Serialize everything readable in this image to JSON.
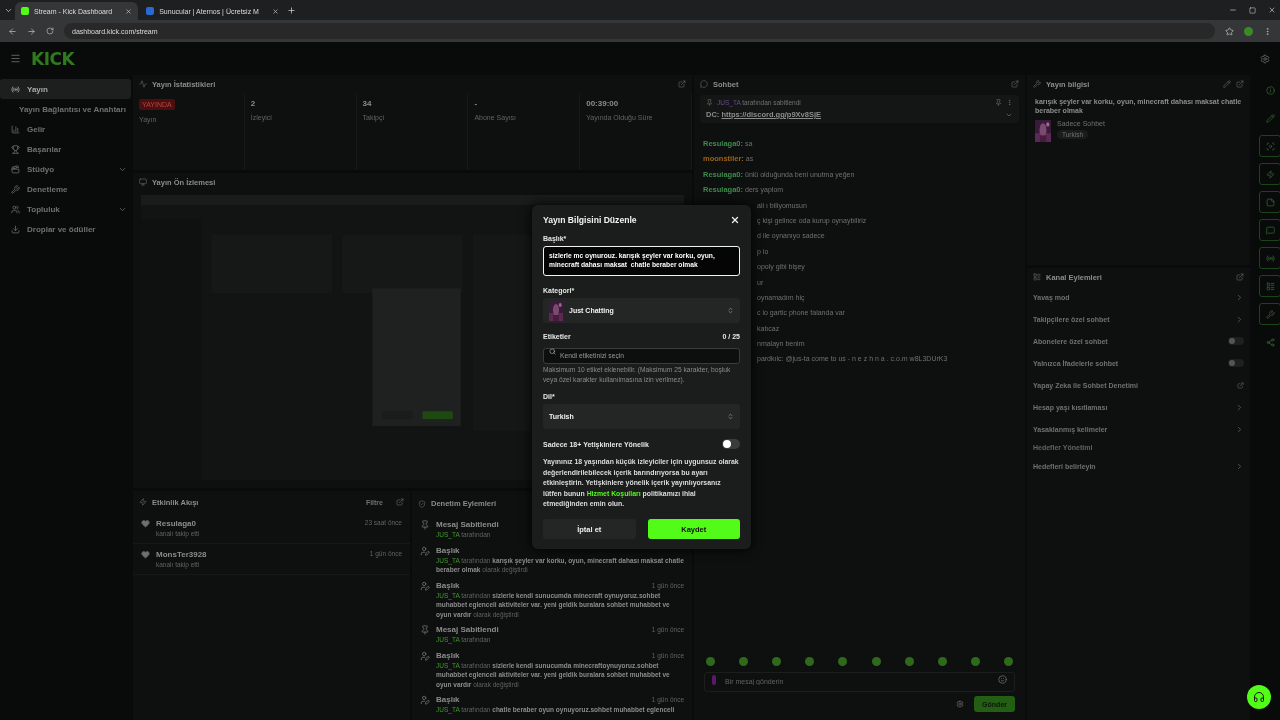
{
  "browser": {
    "tabs": [
      {
        "title": "Stream - Kick Dashboard",
        "selected": true
      },
      {
        "title": "Sunucular | Aternos | Ücretsiz M",
        "selected": false
      }
    ],
    "url": "dashboard.kick.com/stream"
  },
  "header": {
    "logo": "KICK"
  },
  "sidebar": {
    "items": [
      {
        "kind": "item",
        "label": "Yayın",
        "selected": true
      },
      {
        "kind": "subitem",
        "label": "Yayın Bağlantısı ve Anahtarı",
        "selected": false
      },
      {
        "kind": "item",
        "label": "Gelir",
        "selected": false
      },
      {
        "kind": "item",
        "label": "Başarılar",
        "selected": false
      },
      {
        "kind": "group",
        "label": "Stüdyo",
        "selected": false,
        "expanded": false
      },
      {
        "kind": "item",
        "label": "Denetleme",
        "selected": false
      },
      {
        "kind": "group",
        "label": "Topluluk",
        "selected": false,
        "expanded": false
      },
      {
        "kind": "item",
        "label": "Droplar ve ödüller",
        "selected": false
      }
    ]
  },
  "stats": {
    "title": "Yayın İstatistikleri",
    "items": [
      {
        "kind": "badge",
        "value": "YAYINDA",
        "label": "Yayın"
      },
      {
        "kind": "text",
        "value": "2",
        "label": "İzleyici"
      },
      {
        "kind": "text",
        "value": "34",
        "label": "Takipçi"
      },
      {
        "kind": "text",
        "value": "-",
        "label": "Abone Sayısı"
      },
      {
        "kind": "text",
        "value": "00:39:00",
        "label": "Yayında Olduğu Süre"
      }
    ]
  },
  "preview": {
    "title": "Yayın Ön İzlemesi"
  },
  "activity": {
    "title": "Etkinlik Akışı",
    "filter": "Filtre",
    "events": [
      {
        "user": "Resulaga0",
        "action": "kanalı takip etti",
        "time": "23 saat önce"
      },
      {
        "user": "MonsTer3928",
        "action": "kanalı takip etti",
        "time": "1 gün önce"
      }
    ]
  },
  "moderation": {
    "title": "Denetim Eylemleri",
    "actions": [
      {
        "kind": "pin",
        "title": "Mesaj Sabitlendi",
        "by": "JUS_TA",
        "verb": "tarafından"
      },
      {
        "kind": "title",
        "title": "Başlık",
        "by": "JUS_TA",
        "verb": "tarafından",
        "value": "karışık şeyler var korku, oyun, minecraft dahası maksat chatle beraber olmak",
        "suffix": "olarak değiştirdi"
      },
      {
        "kind": "title",
        "title": "Başlık",
        "time": "1 gün önce",
        "by": "JUS_TA",
        "verb": "tarafından",
        "value": "sizlerle kendi sunucumda minecraft oynuyoruz.sohbet muhabbet eglenceli aktiviteler var. yeni geldik buralara sohbet muhabbet ve oyun vardır",
        "suffix": "olarak değiştirdi"
      },
      {
        "kind": "pin",
        "title": "Mesaj Sabitlendi",
        "time": "1 gün önce",
        "by": "JUS_TA",
        "verb": "tarafından"
      },
      {
        "kind": "title",
        "title": "Başlık",
        "time": "1 gün önce",
        "by": "JUS_TA",
        "verb": "tarafından",
        "value": "sizlerle kendi sunucumda minecraftoynuyoruz.sohbet muhabbet eglenceli aktiviteler var. yeni geldik buralara sohbet muhabbet ve oyun vardır",
        "suffix": "olarak değiştirdi"
      },
      {
        "kind": "title",
        "title": "Başlık",
        "time": "1 gün önce",
        "by": "JUS_TA",
        "verb": "tarafından",
        "value": "chatle beraber oyun oynuyoruz.sohbet muhabbet eglenceli"
      }
    ]
  },
  "chat": {
    "title": "Sohbet",
    "pinned": {
      "by": "JUS_TA",
      "note": "tarafından sabitlendi",
      "label": "DC:",
      "link": "https://discord.gg/p9Xv8SjE"
    },
    "messages": [
      {
        "kind": "full",
        "user": "Resulaga0:",
        "color": "#3f8a4c",
        "text": "sa"
      },
      {
        "kind": "full",
        "user": "moonstiler:",
        "color": "#9a6418",
        "text": "as"
      },
      {
        "kind": "full",
        "user": "Resulaga0:",
        "color": "#3f8a4c",
        "text": "ünlü olduğunda beni unutma yeğen"
      },
      {
        "kind": "full",
        "user": "Resulaga0:",
        "color": "#3f8a4c",
        "text": "ders yaplom"
      },
      {
        "kind": "fragment",
        "text": "ali ı biliyomusun"
      },
      {
        "kind": "fragment",
        "text": "ç kişi gelince oda kurup oynaybiliriz"
      },
      {
        "kind": "fragment",
        "text": "d ile oynanıyo sadece"
      },
      {
        "kind": "fragment",
        "text": "p io"
      },
      {
        "kind": "fragment",
        "text": "opoly gibi bişey"
      },
      {
        "kind": "fragment",
        "text": "ur"
      },
      {
        "kind": "fragment",
        "text": "oynamadım hiç"
      },
      {
        "kind": "fragment",
        "text": "c io gartic phone falanda var"
      },
      {
        "kind": "fragment",
        "text": "katıcaz"
      },
      {
        "kind": "fragment",
        "text": "nmalayn benim"
      },
      {
        "kind": "fragment",
        "text": "pardkılc: @jus-ta come to us - n e z h n a . c.o.m w8L3DUrK3"
      }
    ],
    "placeholder": "Bir mesaj gönderin",
    "send": "Gönder"
  },
  "stream_info": {
    "title": "Yayın bilgisi",
    "stream_title": "karışık şeyler var korku, oyun, minecraft dahası maksat chatle beraber olmak",
    "category": "Sadece Sohbet",
    "tag": "Turkish"
  },
  "channel_actions": {
    "title": "Kanal Eylemleri",
    "items": [
      {
        "kind": "link",
        "label": "Yavaş mod"
      },
      {
        "kind": "link",
        "label": "Takipçilere özel sohbet"
      },
      {
        "kind": "toggle",
        "label": "Abonelere özel sohbet",
        "on": false
      },
      {
        "kind": "toggle",
        "label": "Yalnızca İfadelerle sohbet",
        "on": false
      },
      {
        "kind": "external",
        "label": "Yapay Zeka ile Sohbet Denetimi"
      },
      {
        "kind": "link",
        "label": "Hesap yaşı kısıtlaması"
      },
      {
        "kind": "link",
        "label": "Yasaklanmış kelimeler"
      },
      {
        "kind": "heading",
        "label": "Hedefler Yönetimi"
      },
      {
        "kind": "link",
        "label": "Hedefleri belirleyin"
      }
    ]
  },
  "modal": {
    "title": "Yayın Bilgisini Düzenle",
    "title_label": "Başlık*",
    "title_value": "sizlerle mc oynurouz. karışık şeyler var korku, oyun, minecraft dahası maksat  chatle beraber olmak",
    "category_label": "Kategori*",
    "category": "Just Chatting",
    "tags_label": "Etiketler",
    "tags_count": "0 / 25",
    "tags_placeholder": "Kendi etiketinizi seçin",
    "tags_help": "Maksimum 10 etiket eklenebilir. (Maksimum 25 karakter, boşluk veya özel karakter kullanılmasına izin verilmez).",
    "language_label": "Dil*",
    "language": "Turkish",
    "adult_label": "Sadece 18+ Yetişkinlere Yönelik",
    "adult_on": false,
    "adult_info_before": "Yayınınız 18 yaşından küçük izleyiciler için uygunsuz olarak değerlendirilebilecek içerik barındırıyorsa bu ayarı etkinleştirin. Yetişkinlere yönelik içerik yayınlıyorsanız lütfen bunun",
    "adult_link": "Hizmet Koşulları",
    "adult_info_after": "politikamızı ihlal etmediğinden emin olun.",
    "cancel": "İptal et",
    "save": "Kaydet"
  }
}
